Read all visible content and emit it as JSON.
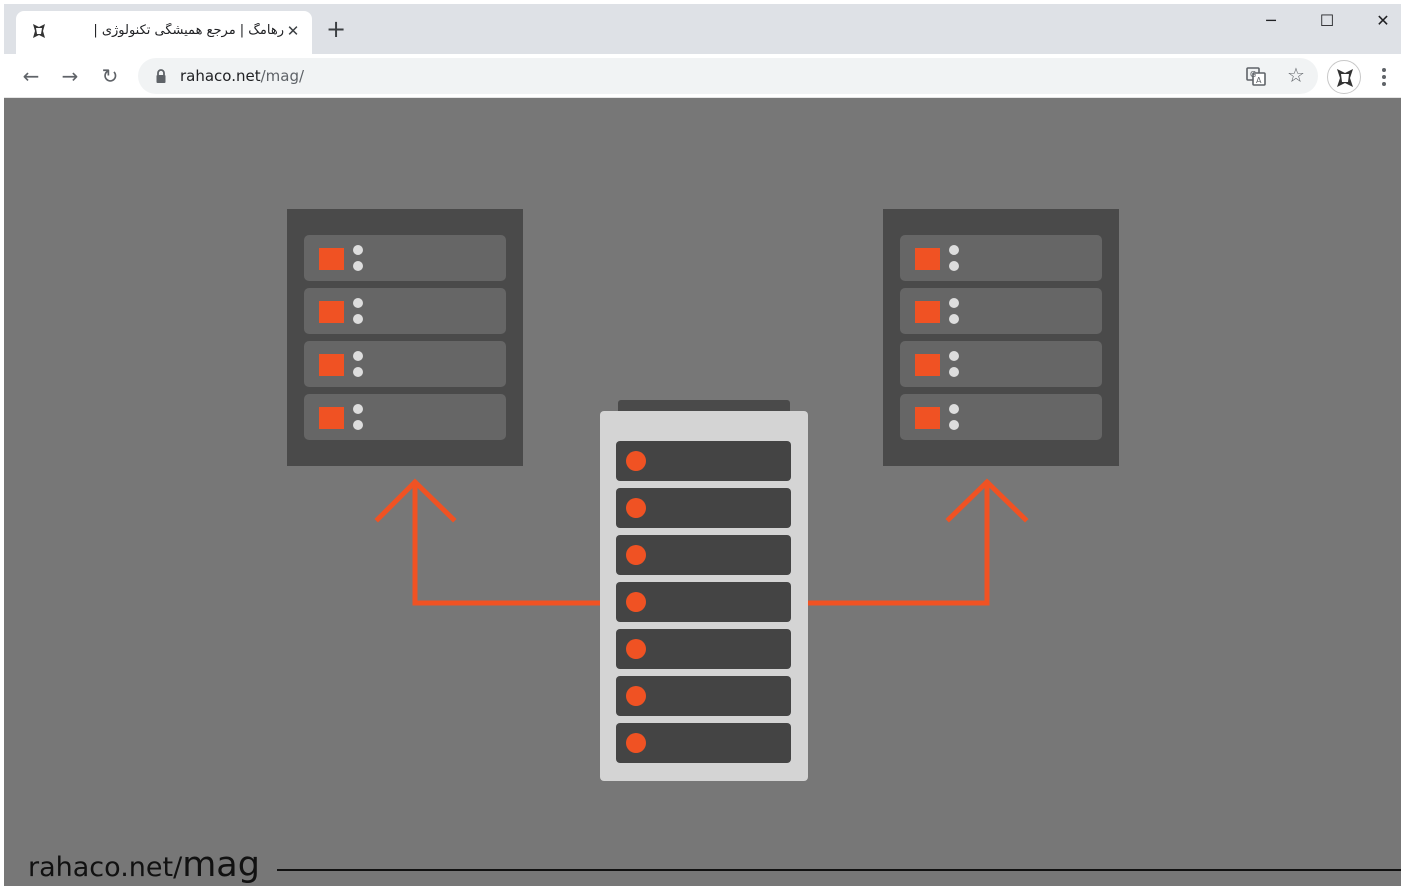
{
  "browser": {
    "tab": {
      "title": "رهامگ | مرجع همیشگی تکنولوژی |",
      "close_glyph": "✕",
      "favicon": "rahaco-logo-icon"
    },
    "new_tab_glyph": "+",
    "window_controls": {
      "minimize": "─",
      "maximize": "☐",
      "close": "✕"
    },
    "nav": {
      "back": "←",
      "forward": "→",
      "reload": "↻"
    },
    "address": {
      "host": "rahaco.net",
      "path": "/mag/"
    },
    "icons": {
      "lock": "lock-icon",
      "translate": "translate-icon",
      "bookmark": "☆",
      "profile": "profile-avatar-icon",
      "menu": "kebab-menu-icon"
    }
  },
  "page": {
    "background_color": "#777777",
    "accent_color": "#f05223",
    "watermark": {
      "host": "rahaco.net/",
      "path": "mag"
    },
    "illustration": {
      "description_icons": [
        "server-rack-left",
        "server-rack-right",
        "central-server",
        "arrow-left",
        "arrow-right"
      ],
      "rack_units_per_side_server": 4,
      "central_server_units": 7
    }
  }
}
